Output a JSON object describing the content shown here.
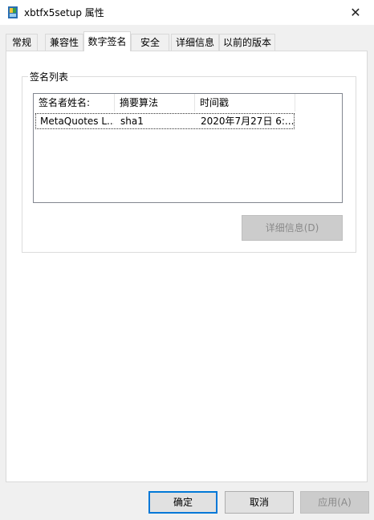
{
  "window": {
    "title": "xbtfx5setup 属性",
    "close_symbol": "✕",
    "app_icon": "installer-icon"
  },
  "tabs": [
    {
      "label": "常规",
      "active": false
    },
    {
      "label": "兼容性",
      "active": false
    },
    {
      "label": "数字签名",
      "active": true
    },
    {
      "label": "安全",
      "active": false
    },
    {
      "label": "详细信息",
      "active": false
    },
    {
      "label": "以前的版本",
      "active": false
    }
  ],
  "signature_group": {
    "label": "签名列表",
    "columns": [
      "签名者姓名:",
      "摘要算法",
      "时间戳"
    ],
    "rows": [
      [
        "MetaQuotes L...",
        "sha1",
        "2020年7月27日 6:..."
      ]
    ],
    "details_button": "详细信息(D)"
  },
  "footer": {
    "ok": "确定",
    "cancel": "取消",
    "apply": "应用(A)"
  },
  "colors": {
    "accent": "#0078d7",
    "disabled_button": "#cccccc"
  }
}
